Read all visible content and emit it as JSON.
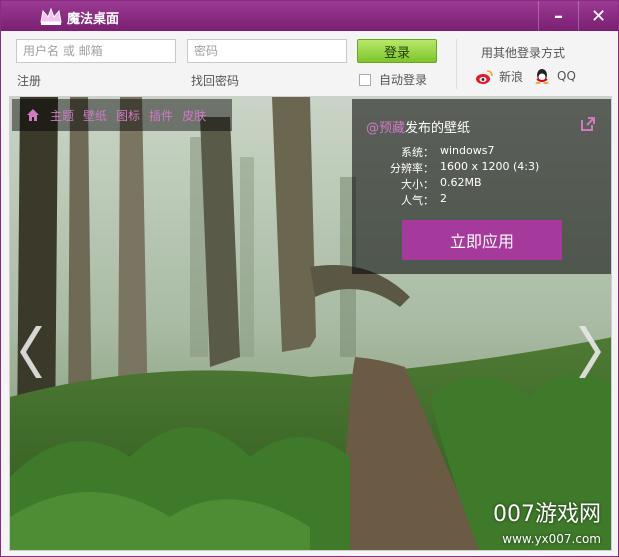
{
  "window": {
    "title": "魔法桌面"
  },
  "login": {
    "username_placeholder": "用户名 或 邮箱",
    "password_placeholder": "密码",
    "login_button": "登录",
    "register_link": "注册",
    "forgot_link": "找回密码",
    "auto_login_label": "自动登录",
    "auto_login_checked": false,
    "other_login_title": "用其他登录方式",
    "social": [
      {
        "label": "新浪",
        "icon": "weibo-icon"
      },
      {
        "label": "QQ",
        "icon": "qq-icon"
      }
    ]
  },
  "nav": {
    "items": [
      "主题",
      "壁纸",
      "图标",
      "插件",
      "皮肤"
    ]
  },
  "wallpaper": {
    "author": "@预藏",
    "title_suffix": "发布的壁纸",
    "rows": [
      {
        "k": "系统：",
        "v": "windows7"
      },
      {
        "k": "分辨率：",
        "v": "1600 x 1200 (4:3)"
      },
      {
        "k": "大小：",
        "v": "0.62MB"
      },
      {
        "k": "人气：",
        "v": "2"
      }
    ],
    "apply_button": "立即应用"
  },
  "watermark": {
    "big": "007游戏网",
    "small": "www.yx007.com"
  },
  "colors": {
    "accent": "#8a2a82",
    "nav_text": "#d07ac6",
    "apply": "#a53a9c",
    "login_green": "#7ec52a"
  }
}
